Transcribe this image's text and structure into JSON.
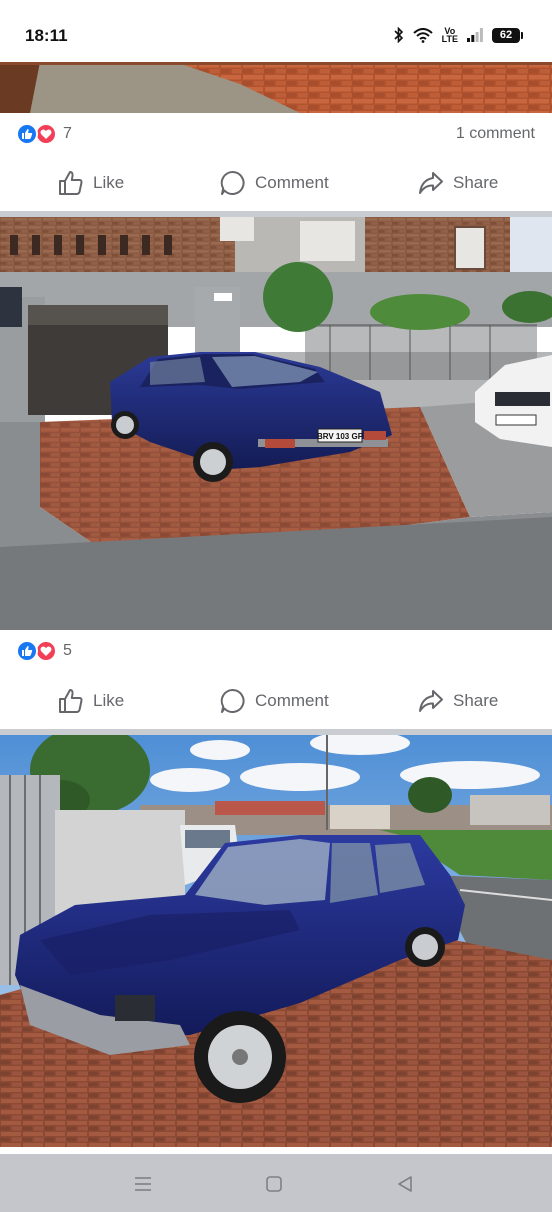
{
  "status_bar": {
    "time": "18:11",
    "lte_top": "Vo",
    "lte_bottom": "LTE",
    "battery": "62",
    "icons": [
      "bluetooth-icon",
      "wifi-icon",
      "volte-icon",
      "signal-icon",
      "battery-icon"
    ]
  },
  "post1": {
    "reaction_count": "7",
    "comment_count": "1 comment",
    "actions": {
      "like": "Like",
      "comment": "Comment",
      "share": "Share"
    }
  },
  "post2": {
    "plate_label": "BRV 103 GP",
    "reaction_count": "5",
    "actions": {
      "like": "Like",
      "comment": "Comment",
      "share": "Share"
    }
  },
  "post3": {},
  "colors": {
    "like_blue": "#1877f2",
    "love_red": "#f33e58",
    "action_gray": "#65676b",
    "car_blue": "#1f2a7a"
  },
  "nav_bar": {
    "icons": [
      "recents-icon",
      "home-icon",
      "back-icon"
    ]
  }
}
